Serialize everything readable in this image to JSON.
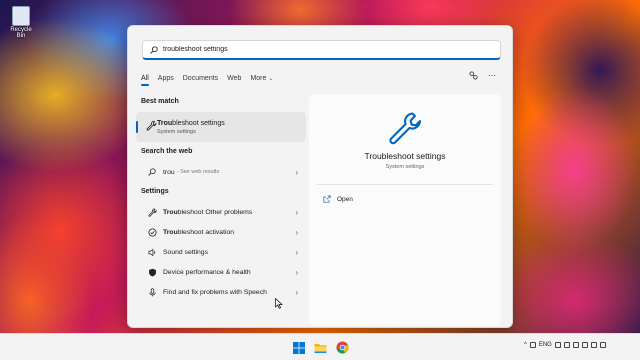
{
  "desktop": {
    "recycle_bin_label": "Recycle Bin"
  },
  "search": {
    "query": "troubleshoot settings",
    "typed_part": "trou"
  },
  "filters": {
    "tabs": [
      "All",
      "Apps",
      "Documents",
      "Web"
    ],
    "more_label": "More",
    "more_chevron": "⌄",
    "active_tab": "All"
  },
  "top_actions": {
    "share_icon": "share-icon",
    "more_icon": "⋯"
  },
  "best_match": {
    "heading": "Best match",
    "title_hl": "Trou",
    "title_rest": "bleshoot settings",
    "subtitle": "System settings"
  },
  "search_web": {
    "heading": "Search the web",
    "query": "trou",
    "suffix": "- See web results"
  },
  "settings": {
    "heading": "Settings",
    "items": [
      {
        "hl": "Trou",
        "rest": "bleshoot Other problems",
        "icon": "wrench-icon"
      },
      {
        "hl": "Trou",
        "rest": "bleshoot activation",
        "icon": "check-circle-icon"
      },
      {
        "hl": "",
        "rest": "Sound settings",
        "icon": "speaker-icon"
      },
      {
        "hl": "",
        "rest": "Device performance & health",
        "icon": "shield-icon"
      },
      {
        "hl": "",
        "rest": "Find and fix problems with Speech",
        "icon": "microphone-icon"
      }
    ]
  },
  "preview": {
    "title": "Troubleshoot settings",
    "subtitle": "System settings",
    "open_label": "Open"
  },
  "taskbar": {
    "tray_chevron": "^",
    "language": "ENG",
    "accent": "#0067c0"
  }
}
